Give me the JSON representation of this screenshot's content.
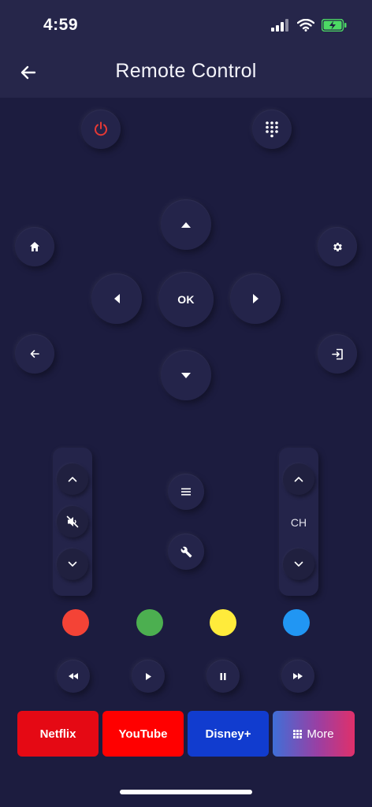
{
  "status_bar": {
    "time": "4:59"
  },
  "header": {
    "title": "Remote Control"
  },
  "dpad": {
    "ok_label": "OK"
  },
  "channel": {
    "label": "CH"
  },
  "apps": [
    {
      "label": "Netflix",
      "color": "#e50914"
    },
    {
      "label": "YouTube",
      "color": "#ff0000"
    },
    {
      "label": "Disney+",
      "color": "#113ccf"
    },
    {
      "label": "More"
    }
  ],
  "color_keys": {
    "red": "#f44336",
    "green": "#4caf50",
    "yellow": "#ffeb3b",
    "blue": "#2196f3"
  },
  "icons": {
    "power": "power-icon",
    "keypad": "keypad-icon",
    "home": "home-icon",
    "settings": "gear-icon",
    "back": "arrow-left-icon",
    "input": "input-icon",
    "mute": "mute-icon",
    "menu": "menu-icon",
    "tools": "wrench-icon"
  }
}
